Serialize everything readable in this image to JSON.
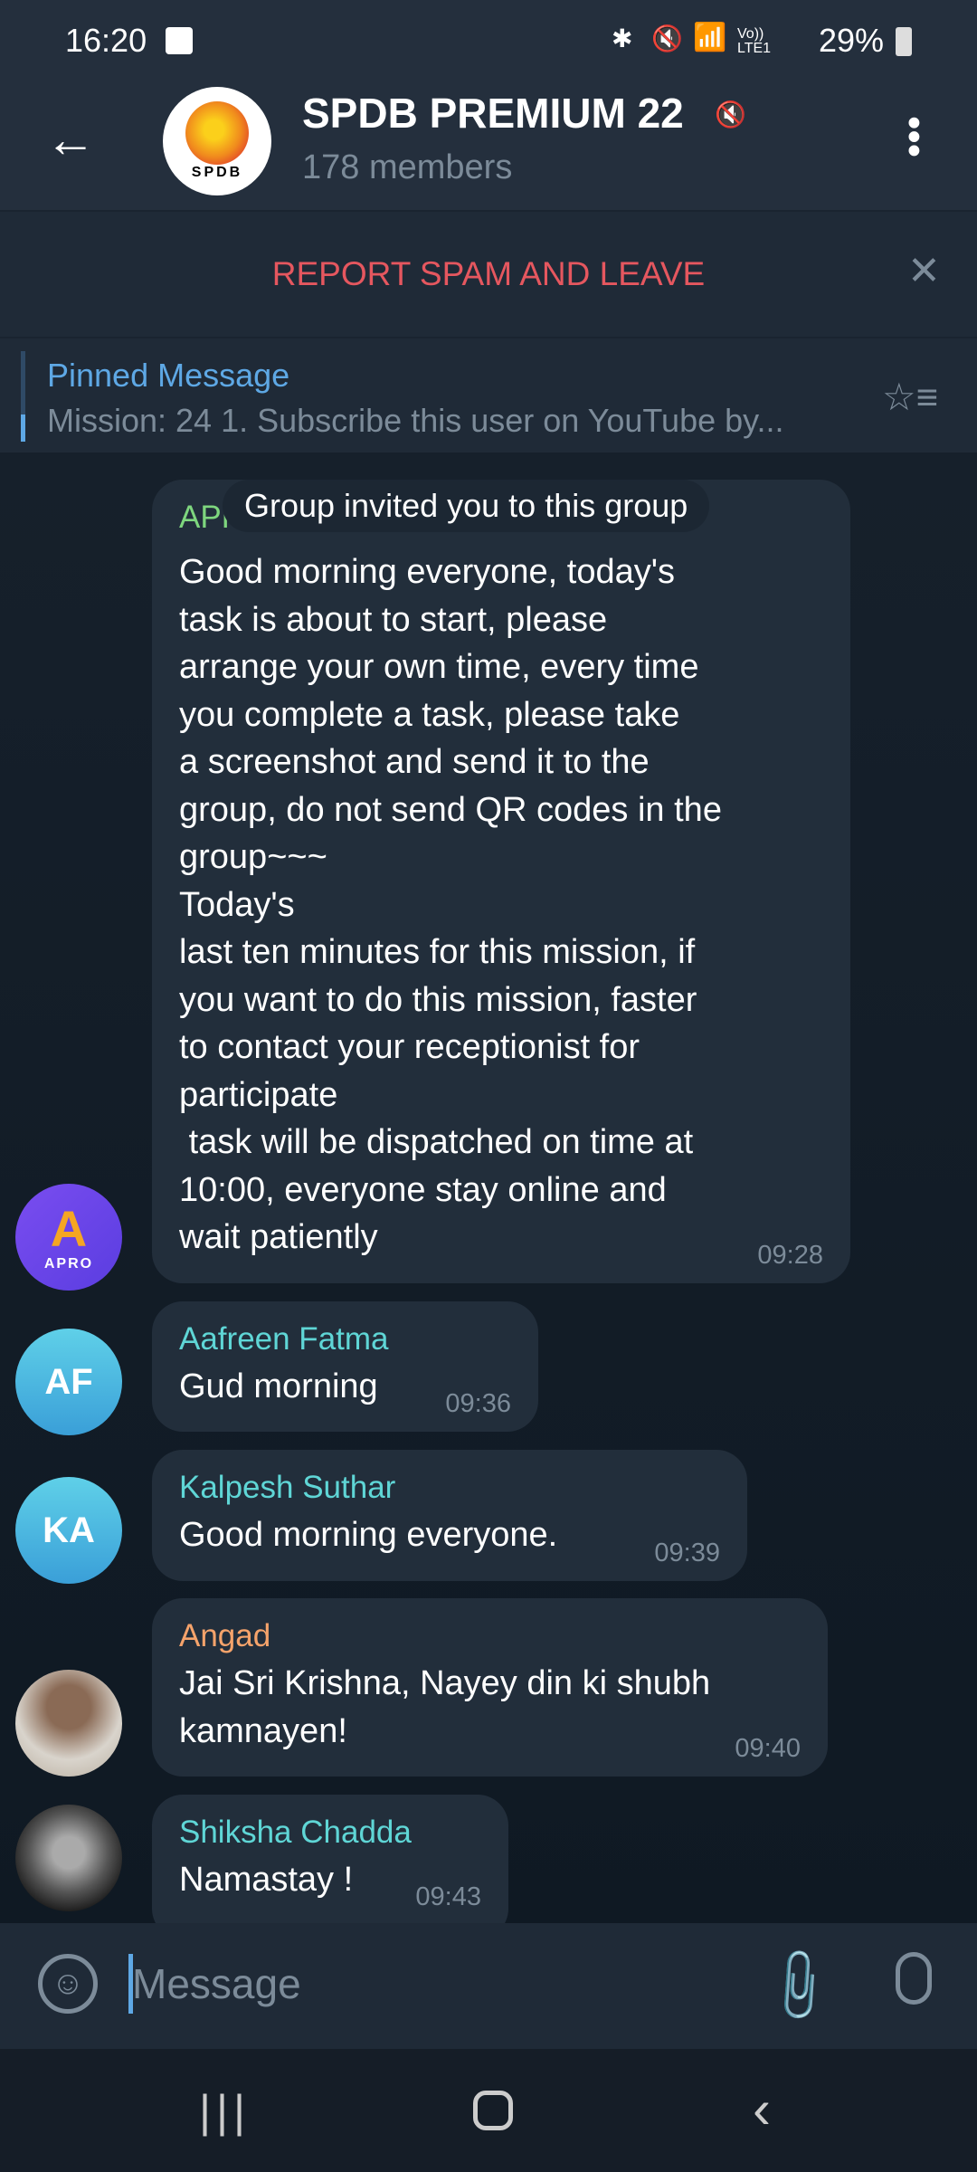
{
  "status_bar": {
    "time": "16:20",
    "battery": "29%",
    "network": "Vo)) LTE1"
  },
  "header": {
    "title": "SPDB PREMIUM 22",
    "subtitle": "178 members",
    "avatar_text": "SPDB"
  },
  "spam_bar": {
    "label": "REPORT SPAM AND LEAVE"
  },
  "pinned": {
    "title": "Pinned Message",
    "preview": "Mission: 24  1. Subscribe this user on YouTube by..."
  },
  "service_message": "Group invited you to this group",
  "messages": [
    {
      "sender": "APRO PREMIUM",
      "sender_color": "#7ed67e",
      "avatar": "APRO",
      "text": "Good morning everyone, today's\ntask is about to start, please\narrange your own time, every time\nyou complete a task, please take\na screenshot and send it to the\ngroup, do not send QR codes in the\ngroup~~~\nToday's\nlast ten minutes for this mission, if\nyou want to do this mission, faster\nto contact your receptionist for\nparticipate\n task will be dispatched on time at\n10:00, everyone stay online and\nwait patiently",
      "time": "09:28"
    },
    {
      "sender": "Aafreen Fatma",
      "sender_color": "#5fd6d6",
      "avatar": "AF",
      "text": "Gud morning",
      "time": "09:36"
    },
    {
      "sender": "Kalpesh Suthar",
      "sender_color": "#5fd6d6",
      "avatar": "KA",
      "text": "Good morning everyone.",
      "time": "09:39"
    },
    {
      "sender": "Angad",
      "sender_color": "#f5a36b",
      "avatar": "photo",
      "text": "Jai Sri Krishna, Nayey din ki shubh\nkamnayen!",
      "time": "09:40"
    },
    {
      "sender": "Shiksha Chadda",
      "sender_color": "#5fd6d6",
      "avatar": "photo",
      "text": "Namastay !",
      "time": "09:43"
    }
  ],
  "input": {
    "placeholder": "Message"
  },
  "colors": {
    "accent": "#5ea8e5",
    "danger": "#e5575f"
  }
}
